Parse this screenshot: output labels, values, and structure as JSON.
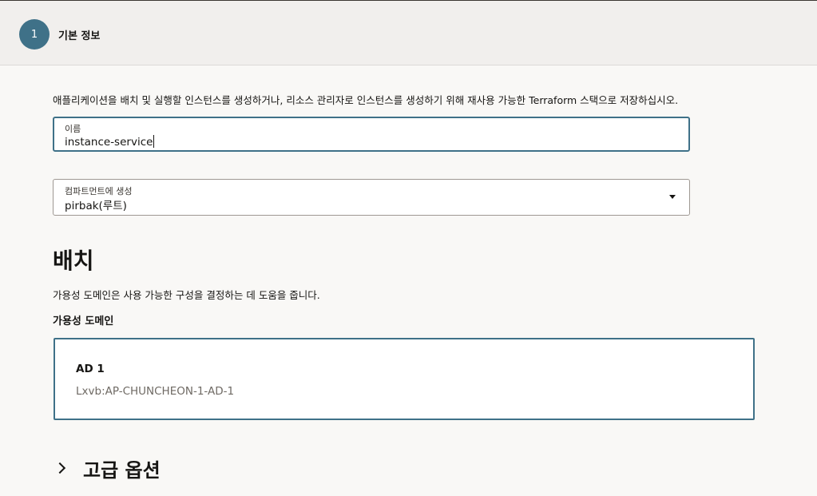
{
  "step": {
    "number": "1",
    "title": "기본 정보"
  },
  "intro_text": "애플리케이션을 배치 및 실행할 인스턴스를 생성하거나, 리소스 관리자로 인스턴스를 생성하기 위해 재사용 가능한 Terraform 스택으로 저장하십시오.",
  "name_field": {
    "label": "이름",
    "value": "instance-service"
  },
  "compartment_field": {
    "label": "컴파트먼트에 생성",
    "value": "pirbak(루트)"
  },
  "placement": {
    "title": "배치",
    "description": "가용성 도메인은 사용 가능한 구성을 결정하는 데 도움을 줍니다.",
    "ad_label": "가용성 도메인",
    "ad_options": [
      {
        "name": "AD 1",
        "id": "Lxvb:AP-CHUNCHEON-1-AD-1",
        "selected": true
      }
    ]
  },
  "advanced_options": {
    "label": "고급 옵션",
    "expanded": false
  },
  "colors": {
    "accent": "#3f7188",
    "background": "#f9f8f6",
    "header_background": "#f1efed"
  },
  "icons": {
    "dropdown": "chevron-down-icon",
    "expander": "chevron-right-icon"
  }
}
